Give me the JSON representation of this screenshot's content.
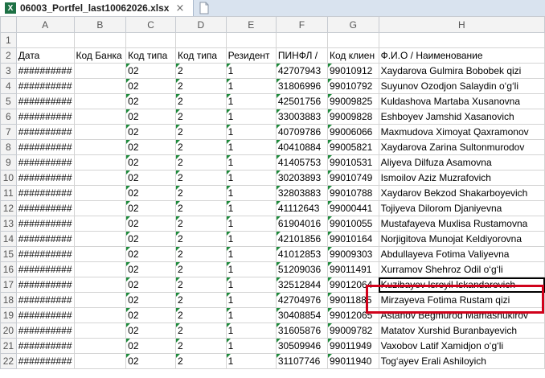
{
  "tab": {
    "title": "06003_Portfel_last10062026.xlsx",
    "close": "×",
    "icon": "X"
  },
  "columns": [
    "A",
    "B",
    "C",
    "D",
    "E",
    "F",
    "G",
    "H"
  ],
  "headers": [
    "Дата",
    "Код Банка",
    "Код типа",
    "Код типа",
    "Резидент",
    "ПИНФЛ /",
    "Код клиен",
    "Ф.И.О / Наименование"
  ],
  "rows": [
    {
      "n": "3",
      "a": "##########",
      "c": "02",
      "d": "2",
      "e": "1",
      "f": "42707943",
      "g": "99010912",
      "h": "Xaydarova Gulmira Bobobek qizi"
    },
    {
      "n": "4",
      "a": "##########",
      "c": "02",
      "d": "2",
      "e": "1",
      "f": "31806996",
      "g": "99010792",
      "h": "Suyunov Ozodjon Salaydin o‘g‘li"
    },
    {
      "n": "5",
      "a": "##########",
      "c": "02",
      "d": "2",
      "e": "1",
      "f": "42501756",
      "g": "99009825",
      "h": "Kuldashova Martaba Xusanovna"
    },
    {
      "n": "6",
      "a": "##########",
      "c": "02",
      "d": "2",
      "e": "1",
      "f": "33003883",
      "g": "99009828",
      "h": "Eshboyev Jamshid Xasanovich"
    },
    {
      "n": "7",
      "a": "##########",
      "c": "02",
      "d": "2",
      "e": "1",
      "f": "40709786",
      "g": "99006066",
      "h": "Maxmudova Ximoyat Qaxramonov"
    },
    {
      "n": "8",
      "a": "##########",
      "c": "02",
      "d": "2",
      "e": "1",
      "f": "40410884",
      "g": "99005821",
      "h": "Xaydarova Zarina Sultonmurodov"
    },
    {
      "n": "9",
      "a": "##########",
      "c": "02",
      "d": "2",
      "e": "1",
      "f": "41405753",
      "g": "99010531",
      "h": "Aliyeva Dilfuza Asamovna"
    },
    {
      "n": "10",
      "a": "##########",
      "c": "02",
      "d": "2",
      "e": "1",
      "f": "30203893",
      "g": "99010749",
      "h": "Ismoilov Aziz Muzrafovich"
    },
    {
      "n": "11",
      "a": "##########",
      "c": "02",
      "d": "2",
      "e": "1",
      "f": "32803883",
      "g": "99010788",
      "h": "Xaydarov Bekzod Shakarboyevich"
    },
    {
      "n": "12",
      "a": "##########",
      "c": "02",
      "d": "2",
      "e": "1",
      "f": "41112643",
      "g": "99000441",
      "h": "Tojiyeva Dilorom Djaniyevna"
    },
    {
      "n": "13",
      "a": "##########",
      "c": "02",
      "d": "2",
      "e": "1",
      "f": "61904016",
      "g": "99010055",
      "h": "Mustafayeva Muxlisa Rustamovna"
    },
    {
      "n": "14",
      "a": "##########",
      "c": "02",
      "d": "2",
      "e": "1",
      "f": "42101856",
      "g": "99010164",
      "h": "Norjigitova Munojat Keldiyorovna"
    },
    {
      "n": "15",
      "a": "##########",
      "c": "02",
      "d": "2",
      "e": "1",
      "f": "41012853",
      "g": "99009303",
      "h": "Abdullayeva Fotima Valiyevna"
    },
    {
      "n": "16",
      "a": "##########",
      "c": "02",
      "d": "2",
      "e": "1",
      "f": "51209036",
      "g": "99011491",
      "h": "Xurramov Shehroz Odil o‘g‘li"
    },
    {
      "n": "17",
      "a": "##########",
      "c": "02",
      "d": "2",
      "e": "1",
      "f": "32512844",
      "g": "99012064",
      "h": "Kuzibayev Isroyil Iskandarovich"
    },
    {
      "n": "18",
      "a": "##########",
      "c": "02",
      "d": "2",
      "e": "1",
      "f": "42704976",
      "g": "99011885",
      "h": "Mirzayeva Fotima Rustam qizi"
    },
    {
      "n": "19",
      "a": "##########",
      "c": "02",
      "d": "2",
      "e": "1",
      "f": "30408854",
      "g": "99012065",
      "h": "Astanov Begmurod Mamashukirov"
    },
    {
      "n": "20",
      "a": "##########",
      "c": "02",
      "d": "2",
      "e": "1",
      "f": "31605876",
      "g": "99009782",
      "h": "Matatov Xurshid Buranbayevich"
    },
    {
      "n": "21",
      "a": "##########",
      "c": "02",
      "d": "2",
      "e": "1",
      "f": "30509946",
      "g": "99011949",
      "h": "Vaxobov Latif Xamidjon o‘g‘li"
    },
    {
      "n": "22",
      "a": "##########",
      "c": "02",
      "d": "2",
      "e": "1",
      "f": "31107746",
      "g": "99011940",
      "h": "Tog‘ayev Erali Ashiloyich"
    }
  ],
  "selected_row": "17",
  "accent_color": "#d0021b"
}
